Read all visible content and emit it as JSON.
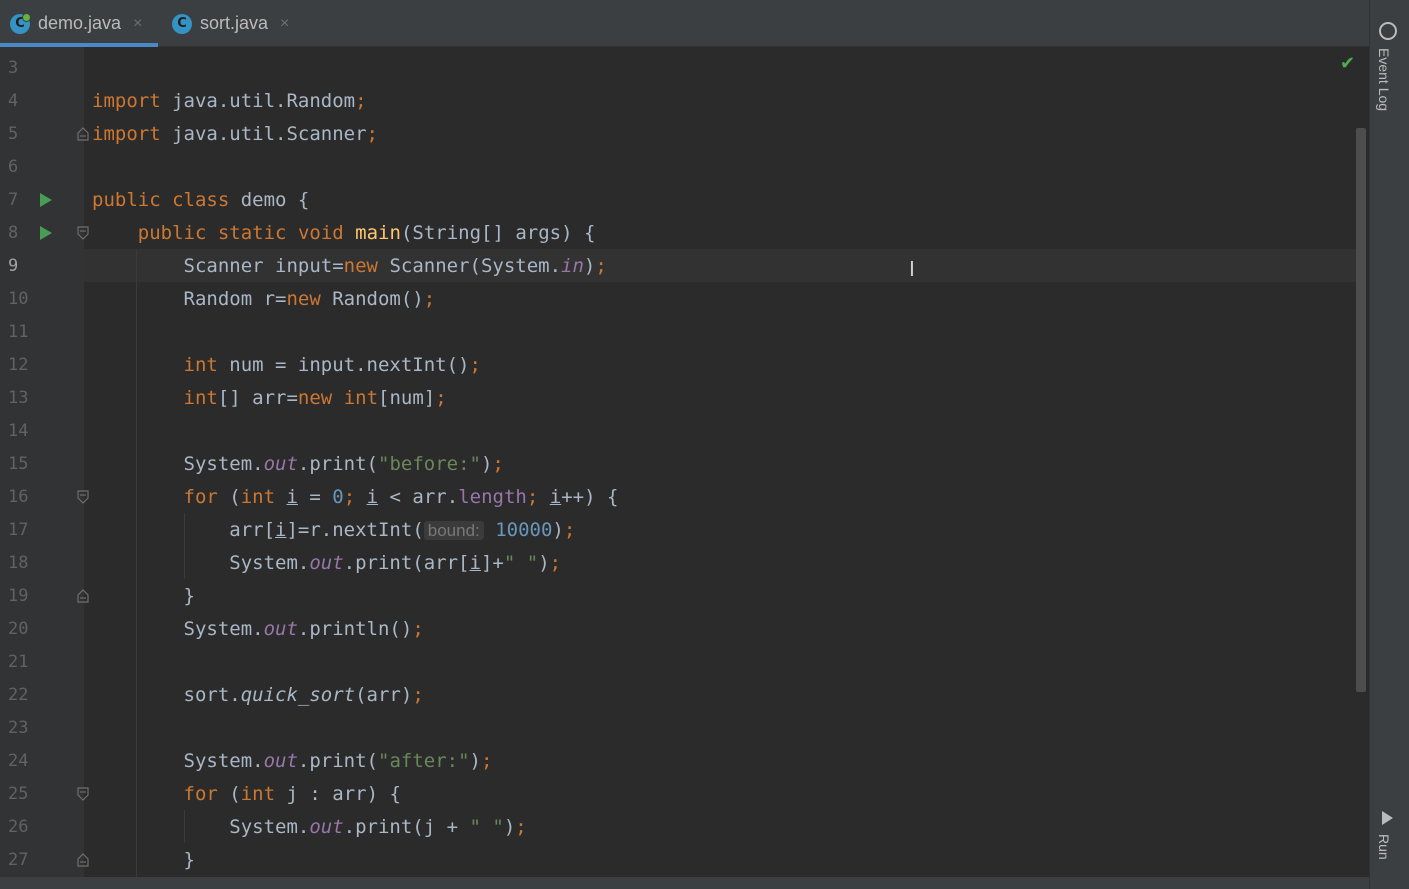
{
  "tabs": [
    {
      "label": "demo.java",
      "icon": "java-class-icon",
      "active": true
    },
    {
      "label": "sort.java",
      "icon": "java-class-icon",
      "active": false
    }
  ],
  "tab_close": "×",
  "tab_icon_letter": "C",
  "side_tools": {
    "event_log": "Event Log",
    "run": "Run"
  },
  "status": {
    "check": "✔"
  },
  "cursor": "I",
  "current_line": 9,
  "colors": {
    "keyword": "#cc7832",
    "method": "#ffc66d",
    "string": "#6a8759",
    "number": "#6897bb",
    "field": "#9876aa",
    "text": "#a9b7c6",
    "tab_underline": "#4a88c7"
  },
  "lines": [
    {
      "n": "3",
      "t": ""
    },
    {
      "n": "4",
      "t": "import java.util.Random;"
    },
    {
      "n": "5",
      "t": "import java.util.Scanner;"
    },
    {
      "n": "6",
      "t": ""
    },
    {
      "n": "7",
      "t": "public class demo {"
    },
    {
      "n": "8",
      "t": "    public static void main(String[] args) {"
    },
    {
      "n": "9",
      "t": "        Scanner input=new Scanner(System.in);"
    },
    {
      "n": "10",
      "t": "        Random r=new Random();"
    },
    {
      "n": "11",
      "t": ""
    },
    {
      "n": "12",
      "t": "        int num = input.nextInt();"
    },
    {
      "n": "13",
      "t": "        int[] arr=new int[num];"
    },
    {
      "n": "14",
      "t": ""
    },
    {
      "n": "15",
      "t": "        System.out.print(\"before:\");"
    },
    {
      "n": "16",
      "t": "        for (int i = 0; i < arr.length; i++) {"
    },
    {
      "n": "17",
      "t": "            arr[i]=r.nextInt( bound: 10000);"
    },
    {
      "n": "18",
      "t": "            System.out.print(arr[i]+\" \");"
    },
    {
      "n": "19",
      "t": "        }"
    },
    {
      "n": "20",
      "t": "        System.out.println();"
    },
    {
      "n": "21",
      "t": ""
    },
    {
      "n": "22",
      "t": "        sort.quick_sort(arr);"
    },
    {
      "n": "23",
      "t": ""
    },
    {
      "n": "24",
      "t": "        System.out.print(\"after:\");"
    },
    {
      "n": "25",
      "t": "        for (int j : arr) {"
    },
    {
      "n": "26",
      "t": "            System.out.print(j + \" \");"
    },
    {
      "n": "27",
      "t": "        }"
    }
  ]
}
